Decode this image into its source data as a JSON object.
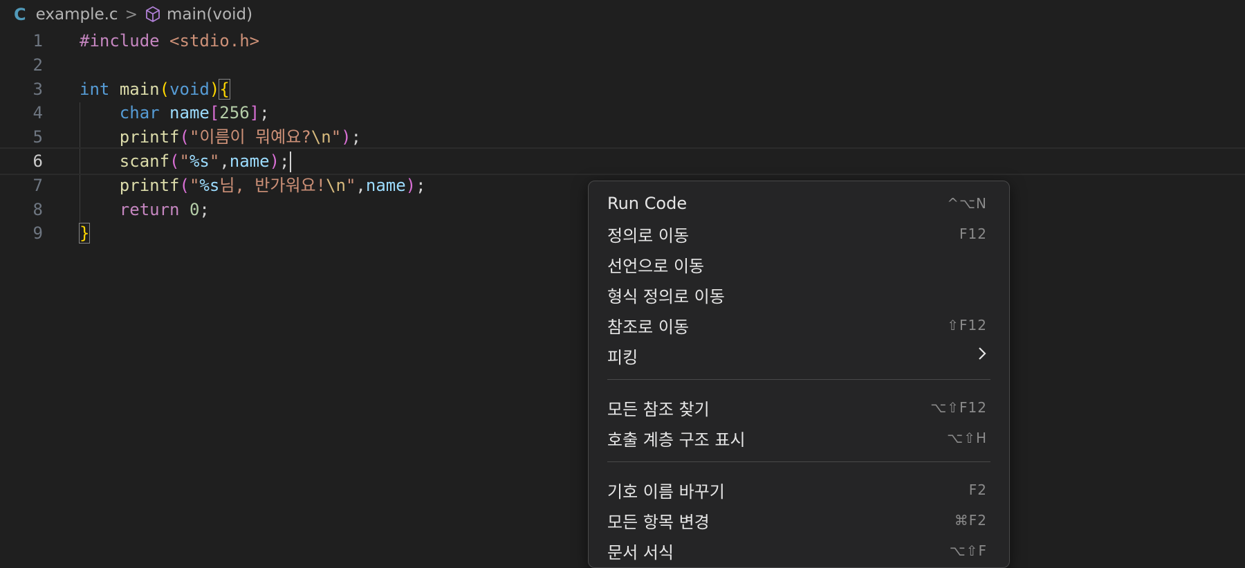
{
  "breadcrumb": {
    "lang_badge": "C",
    "file": "example.c",
    "separator": ">",
    "symbol": "main(void)",
    "symbol_icon": "cube-icon"
  },
  "editor": {
    "line_numbers": [
      "1",
      "2",
      "3",
      "4",
      "5",
      "6",
      "7",
      "8",
      "9"
    ],
    "current_line": 6,
    "lines": [
      [
        {
          "t": "#include",
          "c": "kw-pp"
        },
        {
          "t": " ",
          "c": "plain"
        },
        {
          "t": "<stdio.h>",
          "c": "str"
        }
      ],
      [],
      [
        {
          "t": "int",
          "c": "type"
        },
        {
          "t": " ",
          "c": "plain"
        },
        {
          "t": "main",
          "c": "fn"
        },
        {
          "t": "(",
          "c": "p1"
        },
        {
          "t": "void",
          "c": "type"
        },
        {
          "t": ")",
          "c": "p1"
        },
        {
          "t": "{",
          "c": "p1"
        }
      ],
      [
        {
          "t": "    ",
          "c": "plain"
        },
        {
          "t": "char",
          "c": "type"
        },
        {
          "t": " ",
          "c": "plain"
        },
        {
          "t": "name",
          "c": "var"
        },
        {
          "t": "[",
          "c": "p2"
        },
        {
          "t": "256",
          "c": "num"
        },
        {
          "t": "]",
          "c": "p2"
        },
        {
          "t": ";",
          "c": "plain"
        }
      ],
      [
        {
          "t": "    ",
          "c": "plain"
        },
        {
          "t": "printf",
          "c": "fn"
        },
        {
          "t": "(",
          "c": "p2"
        },
        {
          "t": "\"이름이 뭐예요?",
          "c": "str"
        },
        {
          "t": "\\n",
          "c": "esc"
        },
        {
          "t": "\"",
          "c": "str"
        },
        {
          "t": ")",
          "c": "p2"
        },
        {
          "t": ";",
          "c": "plain"
        }
      ],
      [
        {
          "t": "    ",
          "c": "plain"
        },
        {
          "t": "scanf",
          "c": "fn"
        },
        {
          "t": "(",
          "c": "p2"
        },
        {
          "t": "\"",
          "c": "str"
        },
        {
          "t": "%s",
          "c": "var"
        },
        {
          "t": "\"",
          "c": "str"
        },
        {
          "t": ",",
          "c": "plain"
        },
        {
          "t": "name",
          "c": "var"
        },
        {
          "t": ")",
          "c": "p2"
        },
        {
          "t": ";",
          "c": "plain"
        }
      ],
      [
        {
          "t": "    ",
          "c": "plain"
        },
        {
          "t": "printf",
          "c": "fn"
        },
        {
          "t": "(",
          "c": "p2"
        },
        {
          "t": "\"",
          "c": "str"
        },
        {
          "t": "%s",
          "c": "var"
        },
        {
          "t": "님, 반가워요!",
          "c": "str"
        },
        {
          "t": "\\n",
          "c": "esc"
        },
        {
          "t": "\"",
          "c": "str"
        },
        {
          "t": ",",
          "c": "plain"
        },
        {
          "t": "name",
          "c": "var"
        },
        {
          "t": ")",
          "c": "p2"
        },
        {
          "t": ";",
          "c": "plain"
        }
      ],
      [
        {
          "t": "    ",
          "c": "plain"
        },
        {
          "t": "return",
          "c": "ret"
        },
        {
          "t": " ",
          "c": "plain"
        },
        {
          "t": "0",
          "c": "num"
        },
        {
          "t": ";",
          "c": "plain"
        }
      ],
      [
        {
          "t": "}",
          "c": "p1"
        }
      ]
    ]
  },
  "context_menu": {
    "groups": [
      [
        {
          "label": "Run Code",
          "shortcut": "^⌥N"
        },
        {
          "label": "정의로 이동",
          "shortcut": "F12"
        },
        {
          "label": "선언으로 이동",
          "shortcut": ""
        },
        {
          "label": "형식 정의로 이동",
          "shortcut": ""
        },
        {
          "label": "참조로 이동",
          "shortcut": "⇧F12"
        },
        {
          "label": "피킹",
          "shortcut": "",
          "submenu": true
        }
      ],
      [
        {
          "label": "모든 참조 찾기",
          "shortcut": "⌥⇧F12"
        },
        {
          "label": "호출 계층 구조 표시",
          "shortcut": "⌥⇧H"
        }
      ],
      [
        {
          "label": "기호 이름 바꾸기",
          "shortcut": "F2"
        },
        {
          "label": "모든 항목 변경",
          "shortcut": "⌘F2"
        },
        {
          "label": "문서 서식",
          "shortcut": "⌥⇧F"
        }
      ]
    ]
  },
  "colors": {
    "background": "#1f1f1f",
    "menu_background": "#252526",
    "keyword": "#569cd6",
    "function": "#dcdcaa",
    "string": "#ce9178"
  }
}
